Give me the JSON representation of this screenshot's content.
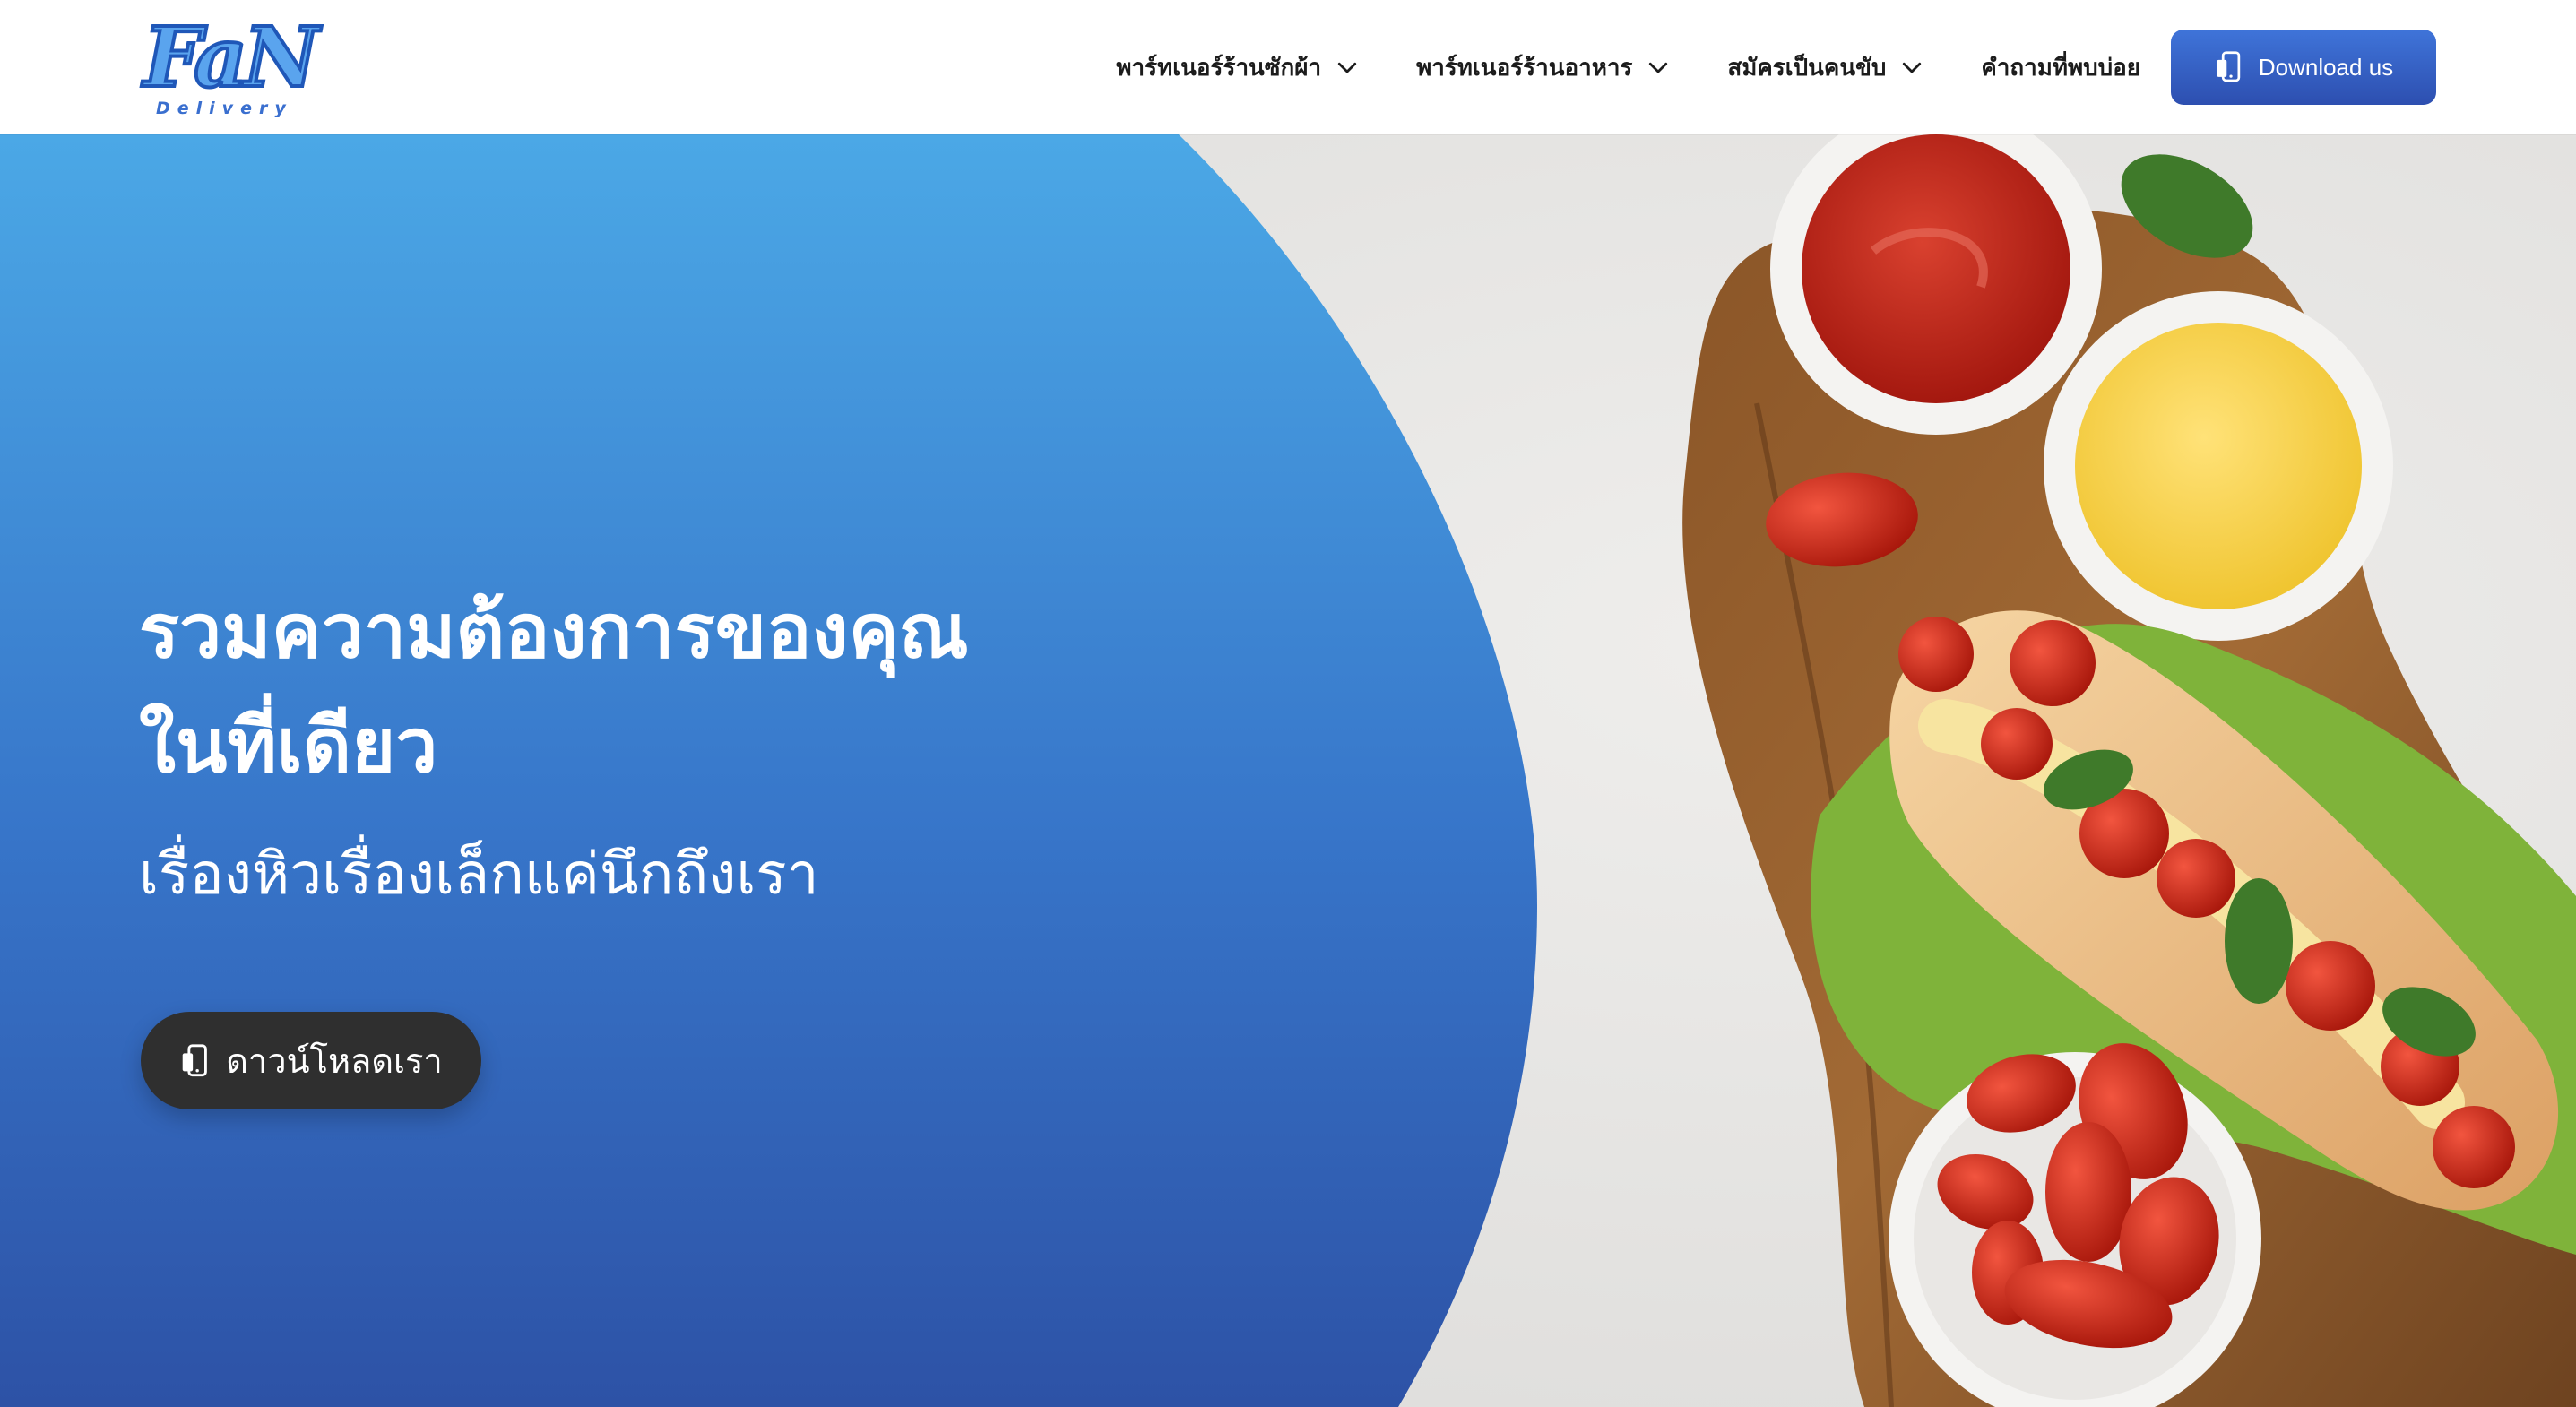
{
  "brand": {
    "logo_text": "FaN",
    "logo_subtext": "Delivery"
  },
  "nav": {
    "items": [
      {
        "label": "พาร์ทเนอร์ร้านซักผ้า",
        "has_dropdown": true
      },
      {
        "label": "พาร์ทเนอร์ร้านอาหาร",
        "has_dropdown": true
      },
      {
        "label": "สมัครเป็นคนขับ",
        "has_dropdown": true
      },
      {
        "label": "คำถามที่พบบ่อย",
        "has_dropdown": false
      }
    ],
    "download_label": "Download us"
  },
  "hero": {
    "headline_line1": "รวมความต้องการของคุณ",
    "headline_line2": "ในที่เดียว",
    "subheadline": "เรื่องหิวเรื่องเล็กแค่นึกถึงเรา",
    "cta_label": "ดาวน์โหลดเรา"
  },
  "colors": {
    "accent": "#3a66cc",
    "hero_gradient_top": "#4ba8e6",
    "hero_gradient_bottom": "#2d52a6",
    "cta_background": "#2f2f2f"
  },
  "icons": [
    "chevron-down-icon",
    "phone-download-icon"
  ]
}
